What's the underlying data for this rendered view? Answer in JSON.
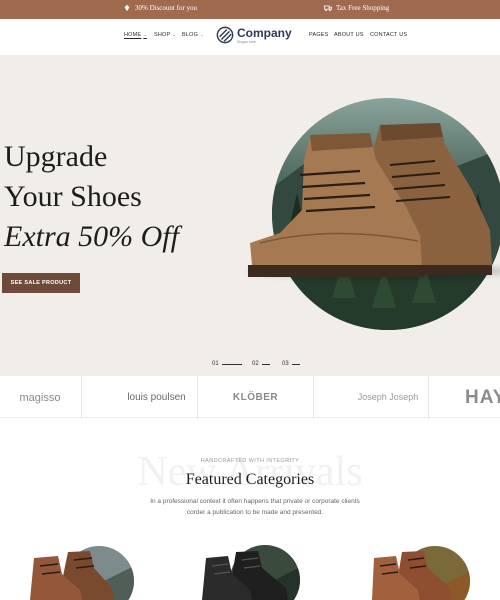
{
  "promo": {
    "discount": "30% Discount for you",
    "shipping": "Tax Free Shopping"
  },
  "nav": {
    "home": "HOME",
    "shop": "SHOP",
    "blog": "BLOG",
    "pages": "PAGES",
    "about": "ABOUT US",
    "contact": "CONTACT US"
  },
  "logo": {
    "name": "Company",
    "slogan": "Slogan here"
  },
  "hero": {
    "line1": "Upgrade",
    "line2": "Your Shoes",
    "line3": "Extra 50% Off",
    "button": "SEE SALE PRODUCT",
    "slides": [
      "01",
      "02",
      "03"
    ]
  },
  "brands": [
    "magisso",
    "louis poulsen",
    "KLÖBER",
    "Joseph Joseph",
    "HAY"
  ],
  "featured": {
    "watermark": "New Arrivals",
    "eyebrow": "HANDCRAFTED WITH INTEGRITY",
    "title": "Featured Categories",
    "description": "In a professional context it often happens that private or corporate clients corder a publication to be made and presented."
  },
  "colors": {
    "brand": "#a06a4f",
    "button": "#6e4a3a",
    "hero_bg": "#f1eee9"
  }
}
